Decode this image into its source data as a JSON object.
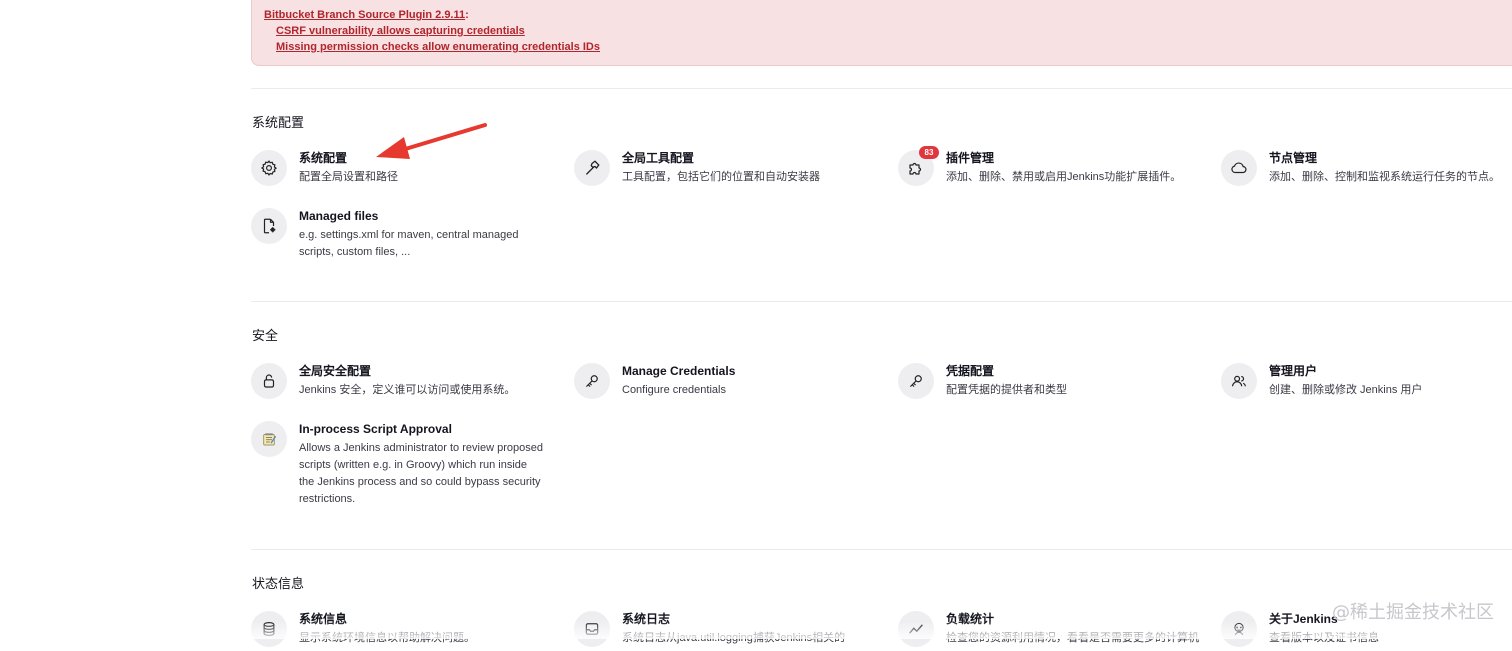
{
  "alert": {
    "plugin": "Bitbucket Branch Source Plugin 2.9.11",
    "colon": ":",
    "links": [
      "CSRF vulnerability allows capturing credentials",
      "Missing permission checks allow enumerating credentials IDs"
    ]
  },
  "sections": {
    "system_config": {
      "title": "系统配置",
      "items": [
        {
          "title": "系统配置",
          "desc": "配置全局设置和路径",
          "icon": "gear-icon"
        },
        {
          "title": "全局工具配置",
          "desc": "工具配置，包括它们的位置和自动安装器",
          "icon": "hammer-icon"
        },
        {
          "title": "插件管理",
          "desc": "添加、删除、禁用或启用Jenkins功能扩展插件。",
          "icon": "puzzle-icon",
          "badge": "83"
        },
        {
          "title": "节点管理",
          "desc": "添加、删除、控制和监视系统运行任务的节点。",
          "icon": "cloud-icon"
        },
        {
          "title": "Managed files",
          "desc": "e.g. settings.xml for maven, central managed scripts, custom files, ...",
          "icon": "file-gear-icon"
        }
      ]
    },
    "security": {
      "title": "安全",
      "items": [
        {
          "title": "全局安全配置",
          "desc": "Jenkins 安全，定义谁可以访问或使用系统。",
          "icon": "lock-icon"
        },
        {
          "title": "Manage Credentials",
          "desc": "Configure credentials",
          "icon": "key-icon"
        },
        {
          "title": "凭据配置",
          "desc": "配置凭据的提供者和类型",
          "icon": "key-icon"
        },
        {
          "title": "管理用户",
          "desc": "创建、删除或修改 Jenkins 用户",
          "icon": "users-icon"
        },
        {
          "title": "In-process Script Approval",
          "desc": "Allows a Jenkins administrator to review proposed scripts (written e.g. in Groovy) which run inside the Jenkins process and so could bypass security restrictions.",
          "icon": "notepad-icon"
        }
      ]
    },
    "status": {
      "title": "状态信息",
      "items": [
        {
          "title": "系统信息",
          "desc": "显示系统环境信息以帮助解决问题。",
          "icon": "database-icon"
        },
        {
          "title": "系统日志",
          "desc": "系统日志从java.util.logging捕获Jenkins相关的",
          "icon": "inbox-icon"
        },
        {
          "title": "负载统计",
          "desc": "检查您的资源利用情况，看看是否需要更多的计算机",
          "icon": "trend-icon"
        },
        {
          "title": "关于Jenkins",
          "desc": "查看版本以及证书信息",
          "icon": "jenkins-icon"
        }
      ]
    }
  },
  "watermark": "@稀土掘金技术社区",
  "colors": {
    "accent_red": "#e0373e",
    "alert_bg": "#f8e1e3",
    "alert_link": "#b0262c",
    "icon_bg": "#eeeef1"
  }
}
